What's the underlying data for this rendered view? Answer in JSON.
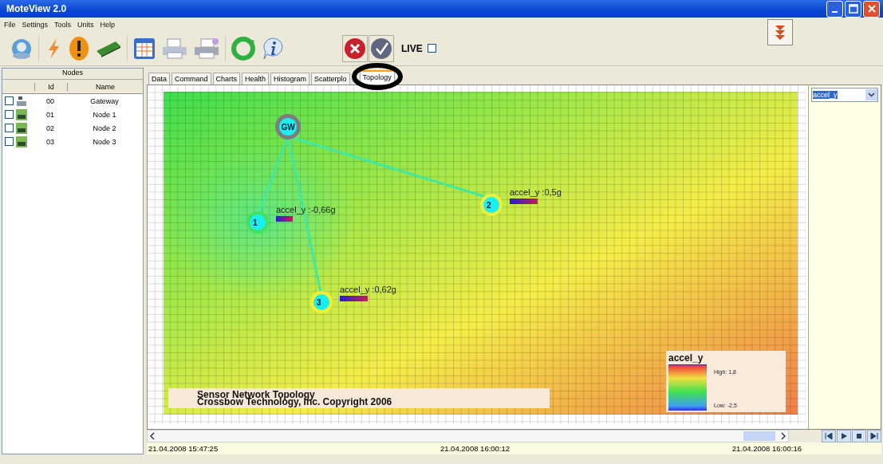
{
  "window": {
    "title": "MoteView 2.0"
  },
  "menu": [
    "File",
    "Settings",
    "Tools",
    "Units",
    "Help"
  ],
  "live": {
    "label": "LIVE",
    "checked": false
  },
  "nodes_panel": {
    "title": "Nodes",
    "columns": [
      "Id",
      "Name"
    ],
    "rows": [
      {
        "kind": "gateway",
        "checked": false,
        "id": "00",
        "name": "Gateway"
      },
      {
        "kind": "mote",
        "checked": false,
        "id": "01",
        "name": "Node 1"
      },
      {
        "kind": "mote",
        "checked": false,
        "id": "02",
        "name": "Node 2"
      },
      {
        "kind": "mote",
        "checked": false,
        "id": "03",
        "name": "Node 3"
      }
    ]
  },
  "tabs": [
    {
      "label": "Data",
      "selected": false
    },
    {
      "label": "Command",
      "selected": false
    },
    {
      "label": "Charts",
      "selected": false
    },
    {
      "label": "Health",
      "selected": false
    },
    {
      "label": "Histogram",
      "selected": false
    },
    {
      "label": "Scatterplo",
      "selected": false
    },
    {
      "label": "Topology",
      "selected": true
    }
  ],
  "topology": {
    "nodes": [
      {
        "kind": "gateway",
        "label": "GW"
      },
      {
        "kind": "mote",
        "label": "1",
        "reading": "accel_y :-0,66g"
      },
      {
        "kind": "mote",
        "label": "2",
        "reading": "accel_y :0,5g"
      },
      {
        "kind": "mote",
        "label": "3",
        "reading": "accel_y :0,62g"
      }
    ],
    "caption": [
      "Sensor Network Topology",
      "Crossbow Technology, Inc. Copyright 2006"
    ],
    "legend": {
      "title": "accel_y",
      "high": "High: 1,8",
      "low": "Low: -2,5"
    }
  },
  "sensor_select": {
    "value": "accel_y"
  },
  "timeline": [
    "21.04.2008 15:47:25",
    "21.04.2008 16:00:12",
    "21.04.2008 16:00:16"
  ]
}
